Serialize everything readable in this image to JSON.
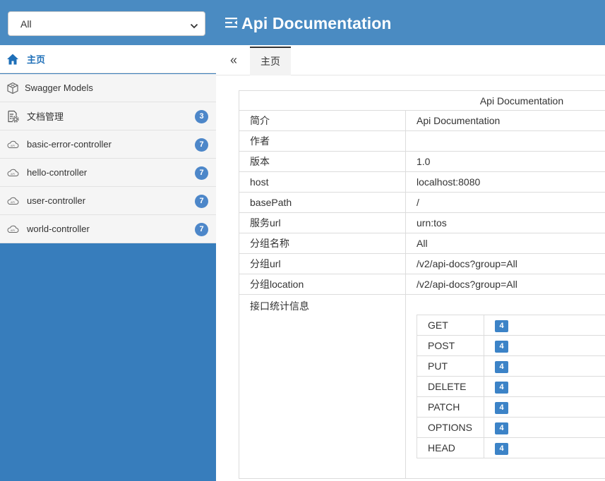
{
  "header": {
    "group_select_value": "All",
    "title": "Api Documentation"
  },
  "sidebar": {
    "items": [
      {
        "label": "主页",
        "icon": "home-icon",
        "active": true
      },
      {
        "label": "Swagger Models",
        "icon": "cube-icon"
      },
      {
        "label": "文档管理",
        "icon": "doc-settings-icon",
        "badge": "3"
      },
      {
        "label": "basic-error-controller",
        "icon": "api-cloud-icon",
        "badge": "7"
      },
      {
        "label": "hello-controller",
        "icon": "api-cloud-icon",
        "badge": "7"
      },
      {
        "label": "user-controller",
        "icon": "api-cloud-icon",
        "badge": "7"
      },
      {
        "label": "world-controller",
        "icon": "api-cloud-icon",
        "badge": "7"
      }
    ]
  },
  "tabs": {
    "collapse_symbol": "«",
    "active_tab": "主页"
  },
  "doc": {
    "table_title": "Api Documentation",
    "rows": [
      {
        "key": "简介",
        "value": "Api Documentation"
      },
      {
        "key": "作者",
        "value": ""
      },
      {
        "key": "版本",
        "value": "1.0"
      },
      {
        "key": "host",
        "value": "localhost:8080"
      },
      {
        "key": "basePath",
        "value": "/"
      },
      {
        "key": "服务url",
        "value": "urn:tos"
      },
      {
        "key": "分组名称",
        "value": "All"
      },
      {
        "key": "分组url",
        "value": "/v2/api-docs?group=All"
      },
      {
        "key": "分组location",
        "value": "/v2/api-docs?group=All"
      }
    ],
    "stats_label": "接口统计信息",
    "methods": [
      {
        "method": "GET",
        "count": "4"
      },
      {
        "method": "POST",
        "count": "4"
      },
      {
        "method": "PUT",
        "count": "4"
      },
      {
        "method": "DELETE",
        "count": "4"
      },
      {
        "method": "PATCH",
        "count": "4"
      },
      {
        "method": "OPTIONS",
        "count": "4"
      },
      {
        "method": "HEAD",
        "count": "4"
      }
    ]
  },
  "colors": {
    "header_bg": "#4a8bc2",
    "sidebar_bg": "#377dbc",
    "badge_bg": "#4d87c9",
    "active_nav_text": "#1e6fb8"
  }
}
